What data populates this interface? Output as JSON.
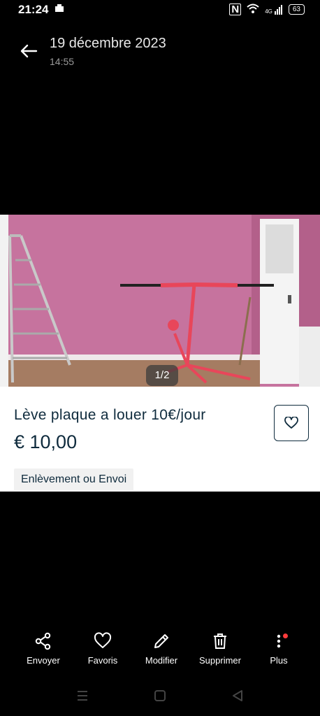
{
  "status_bar": {
    "time": "21:24",
    "battery": "63",
    "network": "4G"
  },
  "header": {
    "date": "19 décembre 2023",
    "time": "14:55"
  },
  "image": {
    "counter": "1/2"
  },
  "listing": {
    "title": "Lève plaque a louer 10€/jour",
    "price": "€ 10,00",
    "delivery": "Enlèvement ou Envoi"
  },
  "actions": [
    {
      "label": "Envoyer",
      "icon": "share-icon"
    },
    {
      "label": "Favoris",
      "icon": "heart-icon"
    },
    {
      "label": "Modifier",
      "icon": "pencil-icon"
    },
    {
      "label": "Supprimer",
      "icon": "trash-icon"
    },
    {
      "label": "Plus",
      "icon": "more-vertical-icon"
    }
  ],
  "colors": {
    "text_dark": "#0f2b3d",
    "notification_dot": "#ff3b3b"
  }
}
